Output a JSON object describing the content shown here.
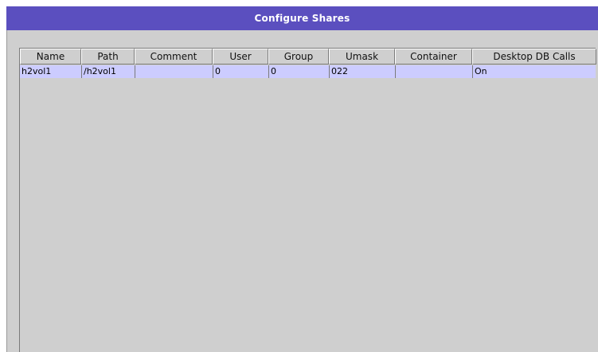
{
  "window": {
    "title": "Configure Shares"
  },
  "colors": {
    "title_bar": "#5b4fbf",
    "panel": "#cfcfcf",
    "selected_row": "#ccccff"
  },
  "table": {
    "columns": [
      "Name",
      "Path",
      "Comment",
      "User",
      "Group",
      "Umask",
      "Container",
      "Desktop DB Calls"
    ],
    "rows": [
      [
        "h2vol1",
        "/h2vol1",
        "",
        "0",
        "0",
        "022",
        "",
        "On"
      ]
    ]
  }
}
